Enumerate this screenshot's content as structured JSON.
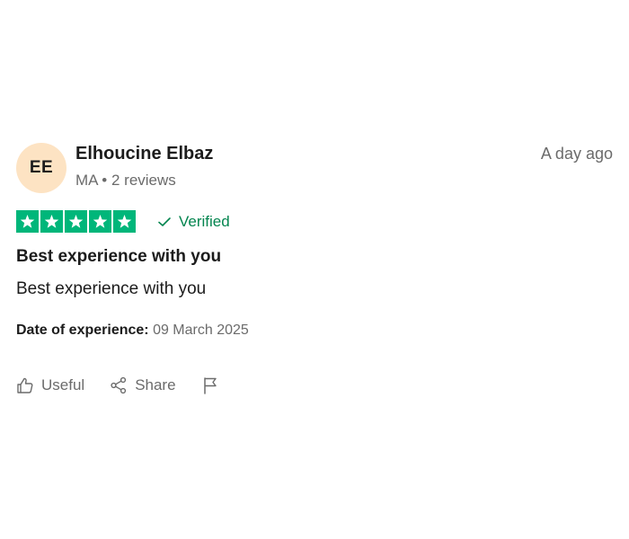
{
  "consumer": {
    "initials": "EE",
    "name": "Elhoucine Elbaz",
    "country": "MA",
    "separator": "•",
    "reviews_count": "2 reviews"
  },
  "review": {
    "posted": "A day ago",
    "rating": 5,
    "rating_max": 5,
    "verified_label": "Verified",
    "title": "Best experience with you",
    "body": "Best experience with you",
    "experience_label": "Date of experience:",
    "experience_date": "09 March 2025"
  },
  "actions": {
    "useful_label": "Useful",
    "share_label": "Share"
  },
  "colors": {
    "star_green": "#00b67a",
    "verified_green": "#04854f",
    "avatar_bg": "#fde3c3"
  }
}
